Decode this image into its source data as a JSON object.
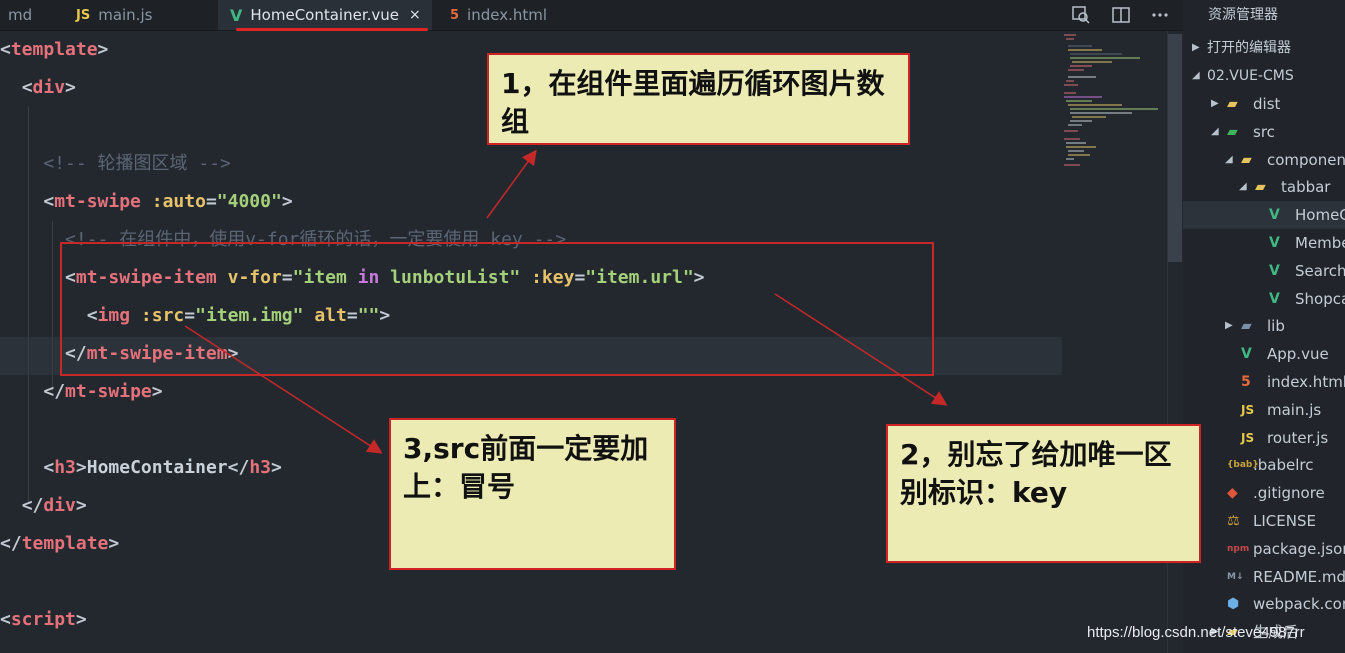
{
  "tabs": [
    {
      "label": "md",
      "icon": "markdown-icon"
    },
    {
      "label": "main.js",
      "icon": "js-icon",
      "icon_text": "JS"
    },
    {
      "label": "HomeContainer.vue",
      "icon": "vue-icon",
      "icon_text": "V",
      "active": true
    },
    {
      "label": "index.html",
      "icon": "html5-icon",
      "icon_text": "5"
    }
  ],
  "close_glyph": "×",
  "explorer_title": "资源管理器",
  "code_lines": [
    {
      "tokens": [
        [
          "br",
          "<"
        ],
        [
          "tag",
          "template"
        ],
        [
          "br",
          ">"
        ]
      ]
    },
    {
      "tokens": [
        [
          "txt",
          "  "
        ],
        [
          "br",
          "<"
        ],
        [
          "tag",
          "div"
        ],
        [
          "br",
          ">"
        ]
      ]
    },
    {
      "tokens": []
    },
    {
      "tokens": [
        [
          "com",
          "    <!-- 轮播图区域 -->"
        ]
      ]
    },
    {
      "tokens": [
        [
          "txt",
          "    "
        ],
        [
          "br",
          "<"
        ],
        [
          "tag",
          "mt-swipe"
        ],
        [
          "txt",
          " "
        ],
        [
          "attr",
          ":auto"
        ],
        [
          "br",
          "="
        ],
        [
          "str",
          "\"4000\""
        ],
        [
          "br",
          ">"
        ]
      ]
    },
    {
      "tokens": [
        [
          "com",
          "      <!-- 在组件中，使用v-for循环的话，一定要使用 key -->"
        ]
      ]
    },
    {
      "tokens": [
        [
          "txt",
          "      "
        ],
        [
          "br",
          "<"
        ],
        [
          "tag",
          "mt-swipe-item"
        ],
        [
          "txt",
          " "
        ],
        [
          "attr",
          "v-for"
        ],
        [
          "br",
          "="
        ],
        [
          "str",
          "\"item "
        ],
        [
          "kw",
          "in"
        ],
        [
          "str",
          " lunbotuList\""
        ],
        [
          "txt",
          " "
        ],
        [
          "attr",
          ":key"
        ],
        [
          "br",
          "="
        ],
        [
          "str",
          "\"item.url\""
        ],
        [
          "br",
          ">"
        ]
      ]
    },
    {
      "tokens": [
        [
          "txt",
          "        "
        ],
        [
          "br",
          "<"
        ],
        [
          "tag",
          "img"
        ],
        [
          "txt",
          " "
        ],
        [
          "attr",
          ":src"
        ],
        [
          "br",
          "="
        ],
        [
          "str",
          "\"item.img\""
        ],
        [
          "txt",
          " "
        ],
        [
          "attr",
          "alt"
        ],
        [
          "br",
          "="
        ],
        [
          "str",
          "\"\""
        ],
        [
          "br",
          ">"
        ]
      ]
    },
    {
      "tokens": [
        [
          "txt",
          "      "
        ],
        [
          "br",
          "</"
        ],
        [
          "tag",
          "mt-swipe-item"
        ],
        [
          "br",
          ">"
        ]
      ]
    },
    {
      "tokens": [
        [
          "txt",
          "    "
        ],
        [
          "br",
          "</"
        ],
        [
          "tag",
          "mt-swipe"
        ],
        [
          "br",
          ">"
        ]
      ]
    },
    {
      "tokens": []
    },
    {
      "tokens": [
        [
          "txt",
          "    "
        ],
        [
          "br",
          "<"
        ],
        [
          "tag",
          "h3"
        ],
        [
          "br",
          ">"
        ],
        [
          "txt",
          "HomeContainer"
        ],
        [
          "br",
          "</"
        ],
        [
          "tag",
          "h3"
        ],
        [
          "br",
          ">"
        ]
      ]
    },
    {
      "tokens": [
        [
          "txt",
          "  "
        ],
        [
          "br",
          "</"
        ],
        [
          "tag",
          "div"
        ],
        [
          "br",
          ">"
        ]
      ]
    },
    {
      "tokens": [
        [
          "br",
          "</"
        ],
        [
          "tag",
          "template"
        ],
        [
          "br",
          ">"
        ]
      ]
    },
    {
      "tokens": []
    },
    {
      "tokens": [
        [
          "br",
          "<"
        ],
        [
          "tag",
          "script"
        ],
        [
          "br",
          ">"
        ]
      ]
    }
  ],
  "explorer": {
    "sections": [
      {
        "label": "打开的编辑器",
        "collapsed": true
      },
      {
        "label": "02.VUE-CMS",
        "collapsed": false
      }
    ],
    "items": [
      {
        "label": "dist",
        "icon": "folder-icon",
        "type": "folder",
        "depth": 1,
        "expanded": false
      },
      {
        "label": "src",
        "icon": "src-folder-icon",
        "type": "folder",
        "depth": 1,
        "expanded": true
      },
      {
        "label": "components",
        "icon": "folder-icon",
        "type": "folder",
        "depth": 2,
        "expanded": true
      },
      {
        "label": "tabbar",
        "icon": "folder-icon",
        "type": "folder",
        "depth": 3,
        "expanded": true
      },
      {
        "label": "HomeContainer.vue",
        "icon": "vue-icon",
        "type": "vue",
        "depth": 4,
        "selected": true
      },
      {
        "label": "MemberContainer.vue",
        "icon": "vue-icon",
        "type": "vue",
        "depth": 4
      },
      {
        "label": "SearchContainer.vue",
        "icon": "vue-icon",
        "type": "vue",
        "depth": 4
      },
      {
        "label": "ShopcarContainer.vue",
        "icon": "vue-icon",
        "type": "vue",
        "depth": 4
      },
      {
        "label": "lib",
        "icon": "lib-folder-icon",
        "type": "folder",
        "depth": 2,
        "expanded": false
      },
      {
        "label": "App.vue",
        "icon": "vue-icon",
        "type": "vue",
        "depth": 2
      },
      {
        "label": "index.html",
        "icon": "html5-icon",
        "type": "html",
        "depth": 2
      },
      {
        "label": "main.js",
        "icon": "js-icon",
        "type": "js",
        "depth": 2
      },
      {
        "label": "router.js",
        "icon": "js-icon",
        "type": "js",
        "depth": 2
      },
      {
        "label": ".babelrc",
        "icon": "babel-icon",
        "type": "babel",
        "depth": 1
      },
      {
        "label": ".gitignore",
        "icon": "git-icon",
        "type": "git",
        "depth": 1
      },
      {
        "label": "LICENSE",
        "icon": "license-icon",
        "type": "lic",
        "depth": 1
      },
      {
        "label": "package.json",
        "icon": "npm-icon",
        "type": "npm",
        "depth": 1
      },
      {
        "label": "README.md",
        "icon": "markdown-icon",
        "type": "md",
        "depth": 1
      },
      {
        "label": "webpack.config.js",
        "icon": "webpack-icon",
        "type": "wp",
        "depth": 1
      },
      {
        "label": "生成后",
        "icon": "folder-icon",
        "type": "folder",
        "depth": 1
      }
    ]
  },
  "annotations": [
    {
      "text": "1，在组件里面遍历循环图片数组"
    },
    {
      "text": "2，别忘了给加唯一区别标识：key"
    },
    {
      "text": "3,src前面一定要加上：冒号"
    }
  ],
  "watermark": "https://blog.csdn.net/steve4987rr",
  "colors": {
    "annotation_border": "#d02424",
    "annotation_fill": "#ecebb4",
    "tag": "#e5717b",
    "string": "#a4d07a",
    "attribute": "#e6c36a"
  }
}
